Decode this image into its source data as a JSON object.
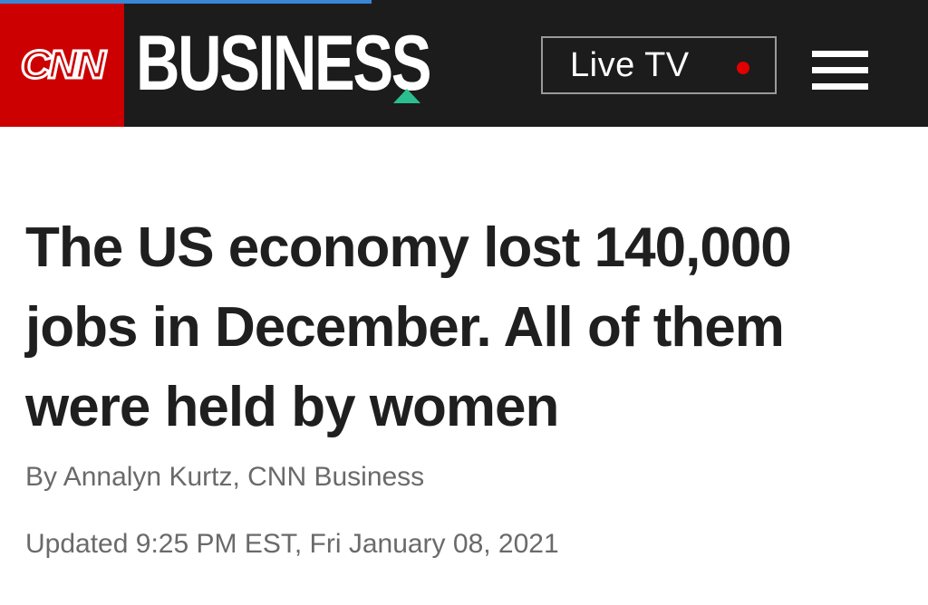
{
  "reading_progress": 0.4,
  "colors": {
    "header_background": "#1c1c1c",
    "logo_red": "#cc0000",
    "accent_green": "#2bbf8f",
    "progress_blue": "#3a86d6",
    "live_dot_red": "#e00000",
    "headline_text": "#1f1f1f",
    "meta_text": "#6a6a6a"
  },
  "header": {
    "logo_text": "CNN",
    "section_name": "BUSINESS",
    "live_tv_label": "Live TV",
    "live_indicator_icon": "red-dot-icon",
    "menu_icon": "hamburger-menu-icon"
  },
  "article": {
    "headline": "The US economy lost 140,000 jobs in December. All of them were held by women",
    "byline": "By Annalyn Kurtz, CNN Business",
    "timestamp": "Updated 9:25 PM EST, Fri January 08, 2021"
  }
}
